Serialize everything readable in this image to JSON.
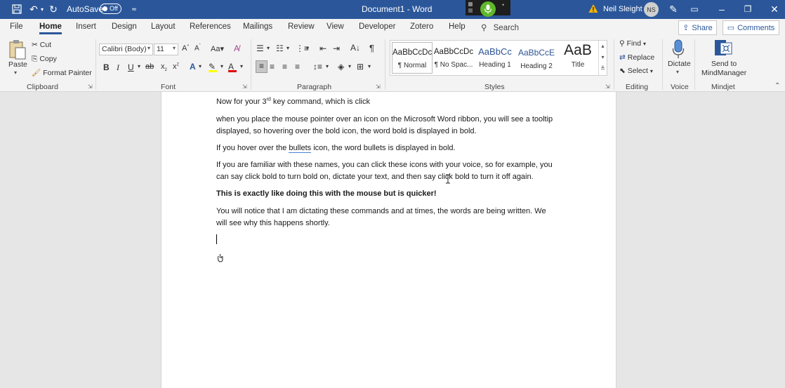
{
  "titlebar": {
    "autosave_label": "AutoSave",
    "autosave_state": "Off",
    "document_title": "Document1 - Word",
    "user_name": "Neil Sleight",
    "user_initials": "NS",
    "mic_color": "#5fb82b"
  },
  "tabs": [
    {
      "label": "File"
    },
    {
      "label": "Home"
    },
    {
      "label": "Insert"
    },
    {
      "label": "Design"
    },
    {
      "label": "Layout"
    },
    {
      "label": "References"
    },
    {
      "label": "Mailings"
    },
    {
      "label": "Review"
    },
    {
      "label": "View"
    },
    {
      "label": "Developer"
    },
    {
      "label": "Zotero"
    },
    {
      "label": "Help"
    }
  ],
  "search_label": "Search",
  "share_label": "Share",
  "comments_label": "Comments",
  "ribbon": {
    "clipboard": {
      "paste": "Paste",
      "cut": "Cut",
      "copy": "Copy",
      "format_painter": "Format Painter",
      "group": "Clipboard"
    },
    "font": {
      "font_name": "Calibri (Body)",
      "font_size": "11",
      "group": "Font"
    },
    "paragraph": {
      "group": "Paragraph"
    },
    "styles": {
      "group": "Styles",
      "items": [
        {
          "preview": "AaBbCcDc",
          "name": "¶ Normal"
        },
        {
          "preview": "AaBbCcDc",
          "name": "¶ No Spac..."
        },
        {
          "preview": "AaBbCc",
          "name": "Heading 1"
        },
        {
          "preview": "AaBbCcE",
          "name": "Heading 2"
        },
        {
          "preview": "AaB",
          "name": "Title"
        }
      ]
    },
    "editing": {
      "find": "Find",
      "replace": "Replace",
      "select": "Select",
      "group": "Editing"
    },
    "voice": {
      "dictate": "Dictate",
      "group": "Voice"
    },
    "mindjet": {
      "send_line1": "Send to",
      "send_line2": "MindManager",
      "group": "Mindjet"
    }
  },
  "document": {
    "p1_before": "Now for your 3",
    "p1_sup": "rd",
    "p1_after": " key command, which is click",
    "p2_line1": "when you place the mouse pointer over an icon on the Microsoft Word ribbon, you will see a tooltip",
    "p2_line2": "displayed, so hovering over the bold icon, the word bold is displayed in bold.",
    "p3_before": "If you hover over the ",
    "p3_word": "bullets",
    "p3_after": " icon, the word bullets is displayed in bold.",
    "p4_line1": "If you are familiar with these names, you can click these icons with your voice, so for example, you",
    "p4_line2": "can say click bold to turn bold on, dictate your text, and then say click bold to turn it off again.",
    "p5": "This is exactly like doing this with the mouse but is quicker!",
    "p6_line1": "You will notice that I am dictating these commands and at times, the words are being written. We",
    "p6_line2": "will see why this happens shortly."
  }
}
